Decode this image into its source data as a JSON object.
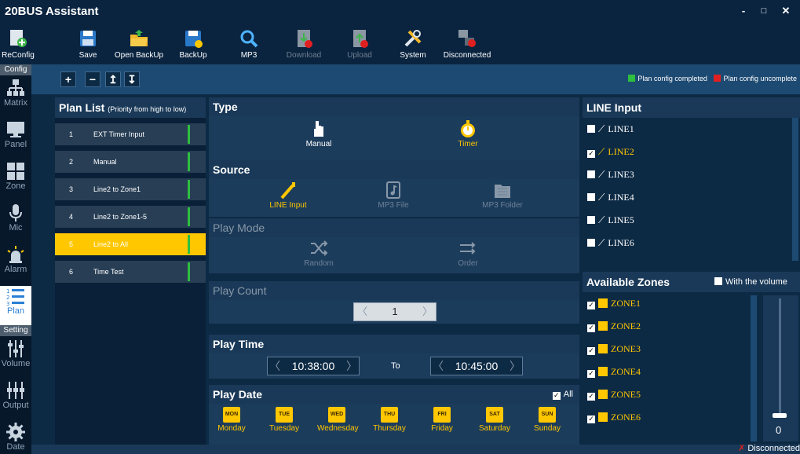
{
  "window": {
    "title": "20BUS Assistant",
    "minimize": "-",
    "maximize": "□",
    "close": "✕"
  },
  "toolbar": [
    {
      "label": "ReConfig",
      "icon": "reconfig-icon",
      "enabled": true
    },
    {
      "label": "Save",
      "icon": "save-icon",
      "enabled": true
    },
    {
      "label": "Open BackUp",
      "icon": "open-folder-icon",
      "enabled": true
    },
    {
      "label": "BackUp",
      "icon": "backup-icon",
      "enabled": true
    },
    {
      "label": "MP3",
      "icon": "search-icon",
      "enabled": true
    },
    {
      "label": "Download",
      "icon": "download-icon",
      "enabled": false
    },
    {
      "label": "Upload",
      "icon": "upload-icon",
      "enabled": false
    },
    {
      "label": "System",
      "icon": "tools-icon",
      "enabled": true
    },
    {
      "label": "Disconnected",
      "icon": "network-disconnected-icon",
      "enabled": true
    }
  ],
  "nav": {
    "config_header": "Config",
    "setting_header": "Setting",
    "config_items": [
      {
        "label": "Matrix",
        "icon": "matrix-icon"
      },
      {
        "label": "Panel",
        "icon": "panel-icon"
      },
      {
        "label": "Zone",
        "icon": "zone-icon"
      },
      {
        "label": "Mic",
        "icon": "mic-icon"
      },
      {
        "label": "Alarm",
        "icon": "alarm-icon"
      },
      {
        "label": "Plan",
        "icon": "plan-icon",
        "active": true
      }
    ],
    "setting_items": [
      {
        "label": "Volume",
        "icon": "volume-icon"
      },
      {
        "label": "Output",
        "icon": "output-icon"
      },
      {
        "label": "Date",
        "icon": "gear-icon"
      }
    ]
  },
  "controls": {
    "add": "+",
    "remove": "−",
    "up": "↥",
    "down": "↧"
  },
  "legend": {
    "completed": "Plan config completed",
    "uncompleted": "Plan config uncomplete",
    "completed_color": "#2fbf3f",
    "uncompleted_color": "#e02020"
  },
  "plan_list": {
    "title": "Plan List",
    "subtitle": "(Priority from high to low)",
    "items": [
      {
        "num": "1",
        "label": "EXT Timer Input"
      },
      {
        "num": "2",
        "label": "Manual"
      },
      {
        "num": "3",
        "label": "Line2 to Zone1"
      },
      {
        "num": "4",
        "label": "Line2 to Zone1-5"
      },
      {
        "num": "5",
        "label": "Line2 to All",
        "selected": true
      },
      {
        "num": "6",
        "label": "Time Test"
      }
    ]
  },
  "type": {
    "title": "Type",
    "manual": "Manual",
    "timer": "Timer"
  },
  "source": {
    "title": "Source",
    "line_input": "LINE Input",
    "mp3_file": "MP3 File",
    "mp3_folder": "MP3 Folder"
  },
  "play_mode": {
    "title": "Play Mode",
    "random": "Random",
    "order": "Order"
  },
  "play_count": {
    "title": "Play Count",
    "value": "1",
    "dec": "〈",
    "inc": "〉"
  },
  "play_time": {
    "title": "Play Time",
    "start": "10:38:00",
    "to": "To",
    "end": "10:45:00",
    "prev": "〈",
    "next": "〉"
  },
  "play_date": {
    "title": "Play Date",
    "all_label": "All",
    "days": [
      {
        "abbr": "MON",
        "label": "Monday"
      },
      {
        "abbr": "TUE",
        "label": "Tuesday"
      },
      {
        "abbr": "WED",
        "label": "Wednesday"
      },
      {
        "abbr": "THU",
        "label": "Thursday"
      },
      {
        "abbr": "FRI",
        "label": "Friday"
      },
      {
        "abbr": "SAT",
        "label": "Saturday"
      },
      {
        "abbr": "SUN",
        "label": "Sunday"
      }
    ]
  },
  "line_input": {
    "title": "LINE Input",
    "items": [
      {
        "label": "LINE1",
        "checked": false
      },
      {
        "label": "LINE2",
        "checked": true
      },
      {
        "label": "LINE3",
        "checked": false
      },
      {
        "label": "LINE4",
        "checked": false
      },
      {
        "label": "LINE5",
        "checked": false
      },
      {
        "label": "LINE6",
        "checked": false
      }
    ]
  },
  "zones": {
    "title": "Available Zones",
    "with_volume": "With the volume",
    "items": [
      {
        "label": "ZONE1"
      },
      {
        "label": "ZONE2"
      },
      {
        "label": "ZONE3"
      },
      {
        "label": "ZONE4"
      },
      {
        "label": "ZONE5"
      },
      {
        "label": "ZONE6"
      }
    ],
    "volume_value": "0"
  },
  "status": {
    "text": "Disconnected"
  }
}
